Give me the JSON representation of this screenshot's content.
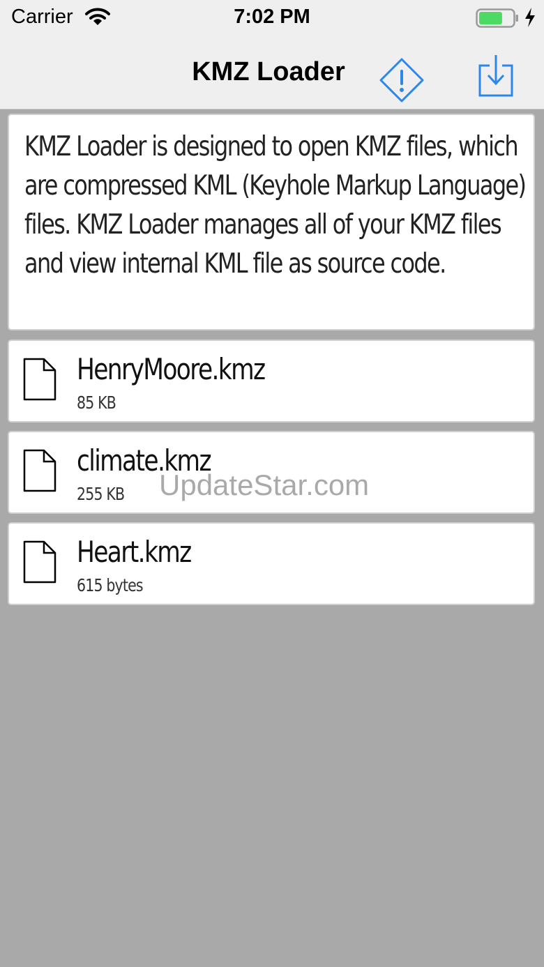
{
  "status_bar": {
    "carrier": "Carrier",
    "time": "7:02 PM",
    "battery_level": 0.7,
    "icons": [
      "wifi-icon",
      "battery-icon",
      "charging-bolt-icon"
    ]
  },
  "nav": {
    "title": "KMZ Loader",
    "icons": [
      "warning-diamond-icon",
      "download-tray-icon"
    ],
    "accent": "#2b87e8"
  },
  "description": "KMZ Loader is designed to open KMZ files, which are compressed KML (Keyhole Markup Language) files. KMZ Loader manages all of your KMZ files and view internal KML file as source code.",
  "files": [
    {
      "name": "HenryMoore.kmz",
      "size": "85 KB"
    },
    {
      "name": "climate.kmz",
      "size": "255 KB"
    },
    {
      "name": "Heart.kmz",
      "size": "615 bytes"
    }
  ],
  "watermark": "UpdateStar.com",
  "colors": {
    "background": "#a9a9a9",
    "bar": "#efefef",
    "card": "#ffffff",
    "battery": "#4cd964"
  }
}
